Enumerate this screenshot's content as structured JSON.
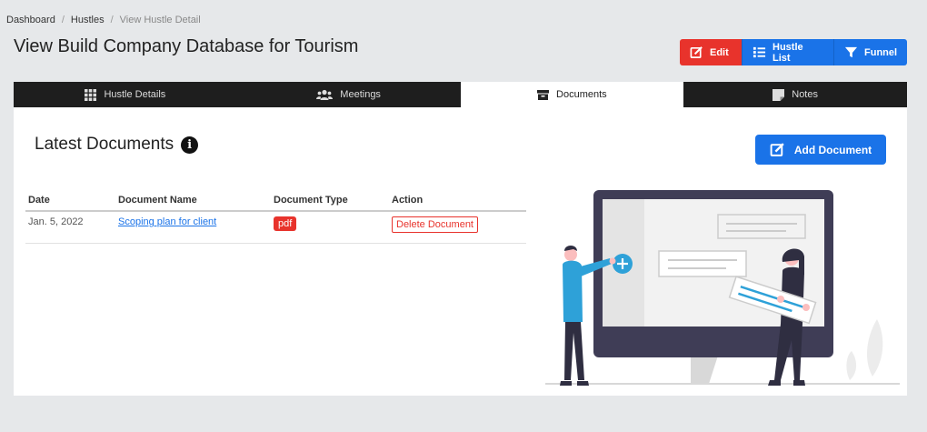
{
  "breadcrumb": {
    "items": [
      "Dashboard",
      "Hustles"
    ],
    "current": "View Hustle Detail",
    "separator": "/"
  },
  "page": {
    "title": "View Build Company Database for Tourism"
  },
  "actions": {
    "edit": "Edit",
    "hustle_list": "Hustle List",
    "funnel": "Funnel"
  },
  "tabs": [
    {
      "label": "Hustle Details",
      "icon": "grid-icon"
    },
    {
      "label": "Meetings",
      "icon": "users-icon"
    },
    {
      "label": "Documents",
      "icon": "archive-icon",
      "active": true
    },
    {
      "label": "Notes",
      "icon": "note-icon"
    }
  ],
  "documents": {
    "title": "Latest Documents",
    "info_glyph": "i",
    "add_label": "Add Document",
    "columns": [
      "Date",
      "Document Name",
      "Document Type",
      "Action"
    ],
    "rows": [
      {
        "date": "Jan. 5, 2022",
        "name": "Scoping plan for client",
        "type": "pdf",
        "action": "Delete Document"
      }
    ]
  },
  "colors": {
    "danger": "#e8332c",
    "primary": "#1a73e8",
    "tab_bar": "#1e1e1e",
    "illustration_accent": "#2ea1d8"
  }
}
